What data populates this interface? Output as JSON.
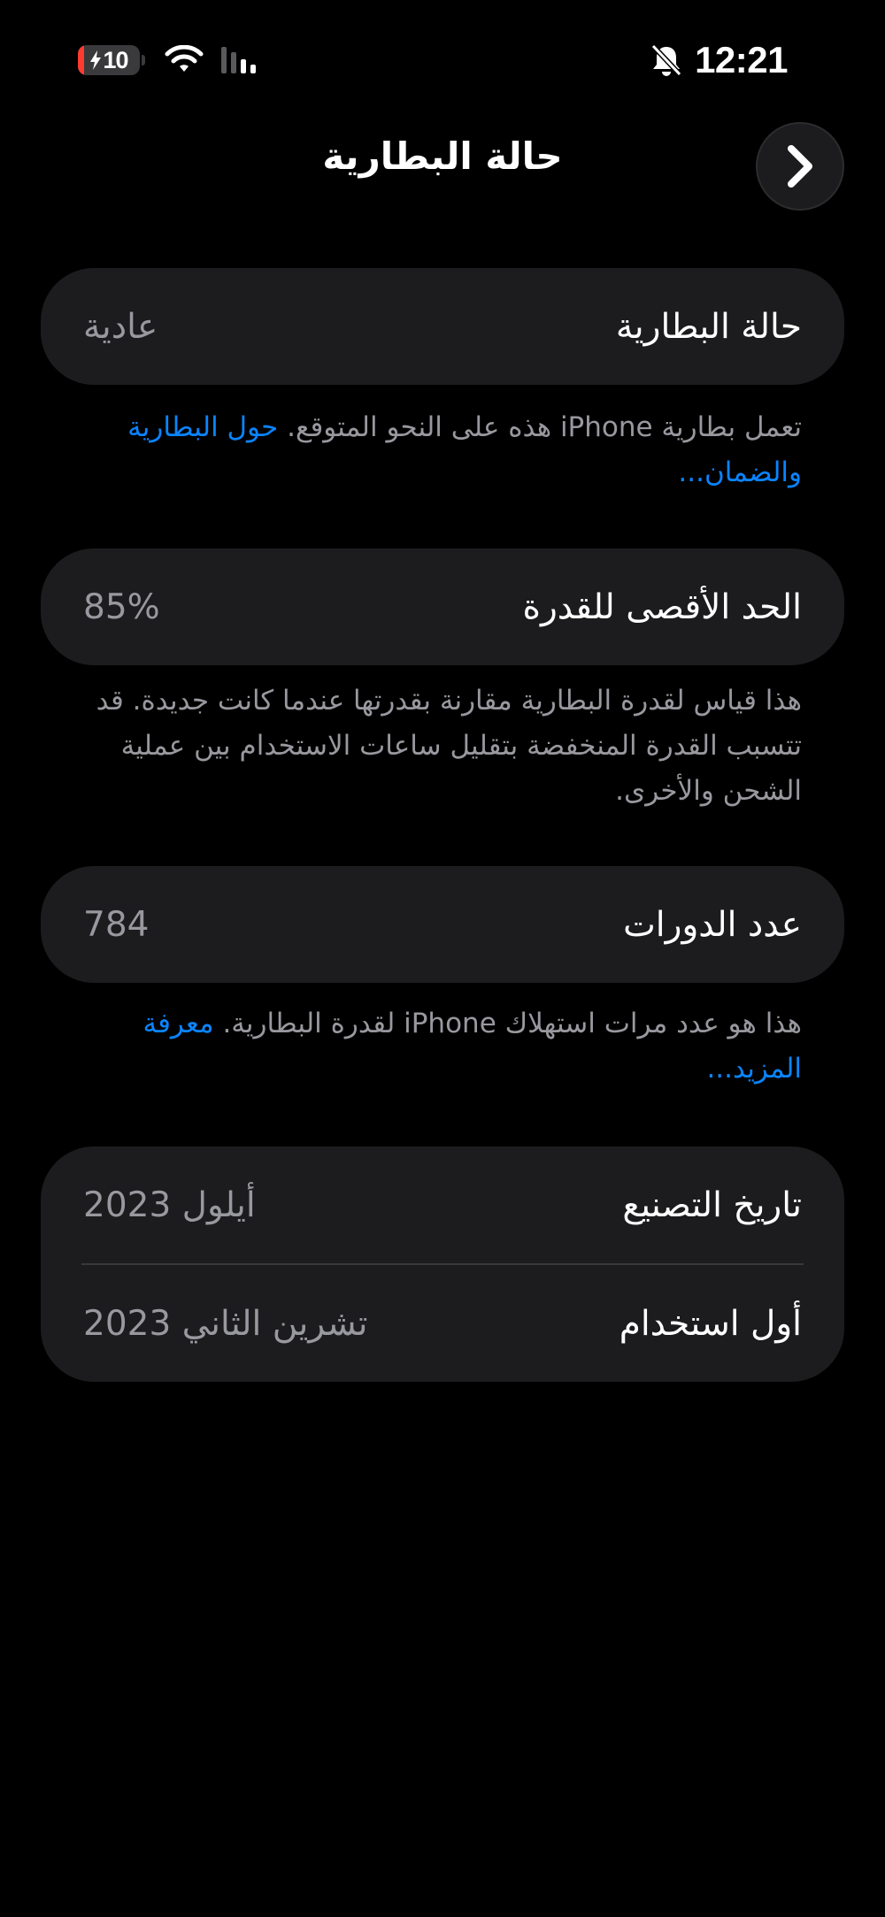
{
  "status_bar": {
    "battery_level": "10",
    "battery_fraction": 0.1,
    "battery_color": "#ff3b30",
    "time": "12:21",
    "icons": [
      "charging-battery-icon",
      "wifi-icon",
      "cellular-signal-icon",
      "silent-bell-icon"
    ]
  },
  "header": {
    "title": "حالة البطارية",
    "back_icon": "chevron-right-icon"
  },
  "battery_condition": {
    "label": "حالة البطارية",
    "value": "عادية",
    "note": "تعمل بطارية iPhone هذه على النحو المتوقع.",
    "note_link": "حول البطارية والضمان..."
  },
  "maximum_capacity": {
    "label": "الحد الأقصى للقدرة",
    "value": "85%",
    "note": "هذا قياس لقدرة البطارية مقارنة بقدرتها عندما كانت جديدة. قد تتسبب القدرة المنخفضة بتقليل ساعات الاستخدام بين عملية الشحن والأخرى."
  },
  "cycle_count": {
    "label": "عدد الدورات",
    "value": "784",
    "note": "هذا هو عدد مرات استهلاك iPhone لقدرة البطارية.",
    "note_link": "معرفة المزيد..."
  },
  "dates": {
    "manufacture_label": "تاريخ التصنيع",
    "manufacture_value": "أيلول 2023",
    "first_use_label": "أول استخدام",
    "first_use_value": "تشرين الثاني 2023"
  },
  "colors": {
    "background": "#000000",
    "card": "#1c1c1e",
    "secondary_text": "#98989f",
    "link": "#0a84ff"
  }
}
